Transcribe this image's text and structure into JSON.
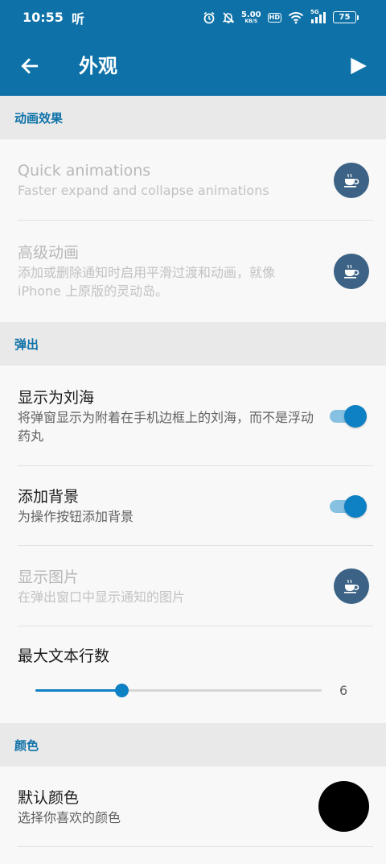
{
  "status_bar": {
    "time": "10:55",
    "carrier": "听",
    "speed_value": "5.00",
    "speed_unit": "KB/S",
    "hd_label": "HD",
    "signal_label": "5G",
    "battery": "75"
  },
  "app_bar": {
    "title": "外观",
    "back_icon": "arrow-left-icon",
    "play_icon": "play-icon"
  },
  "sections": {
    "animation": {
      "header": "动画效果",
      "items": [
        {
          "title": "Quick animations",
          "subtitle": "Faster expand and collapse animations",
          "enabled": false,
          "control": "coffee-icon"
        },
        {
          "title": "高级动画",
          "subtitle": "添加或删除通知时启用平滑过渡和动画，就像 iPhone 上原版的灵动岛。",
          "enabled": false,
          "control": "coffee-icon"
        }
      ]
    },
    "popup": {
      "header": "弹出",
      "items": [
        {
          "title": "显示为刘海",
          "subtitle": "将弹窗显示为附着在手机边框上的刘海，而不是浮动药丸",
          "enabled": true,
          "toggle_on": true
        },
        {
          "title": "添加背景",
          "subtitle": "为操作按钮添加背景",
          "enabled": true,
          "toggle_on": true
        },
        {
          "title": "显示图片",
          "subtitle": "在弹出窗口中显示通知的图片",
          "enabled": false,
          "control": "coffee-icon"
        }
      ],
      "max_lines": {
        "title": "最大文本行数",
        "value": "6",
        "fraction": 0.3
      }
    },
    "color": {
      "header": "颜色",
      "items": [
        {
          "title": "默认颜色",
          "subtitle": "选择你喜欢的颜色",
          "swatch_color": "#000000"
        }
      ]
    }
  },
  "colors": {
    "primary": "#0e72a8",
    "accent": "#0e80c4",
    "coffee_bg": "#3c6385"
  }
}
